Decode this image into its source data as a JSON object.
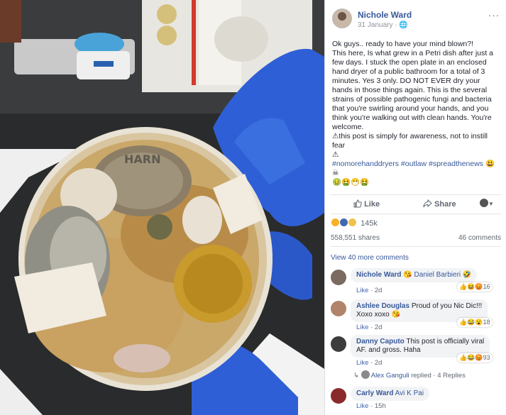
{
  "post": {
    "author": "Nichole Ward",
    "date": "31 January · ",
    "more": "···",
    "text": "Ok guys.. ready to have your mind blown?!\nThis here, Is what grew in a Petri dish after just a few days. I stuck the open plate in an enclosed hand dryer of a public bathroom for a total of 3 minutes. Yes 3 only. DO NOT EVER dry your hands in those things again. This is the several strains of possible pathogenic fungi and bacteria that you're swirling around your hands, and you think you're walking out with clean hands. You're welcome.",
    "warning": "this post is simply for awareness, not to instill fear",
    "hashtags": "#nomorehanddryers #outlaw #spreadthenews"
  },
  "photo": {
    "plate_label": "HARN"
  },
  "actions": {
    "like": "Like",
    "share": "Share"
  },
  "stats": {
    "reactions": "145k",
    "shares": "558,551 shares",
    "comments": "46 comments"
  },
  "view_more": "View 40 more comments",
  "comments": [
    {
      "name": "Nichole Ward",
      "text": "Daniel Barbieri",
      "like": "Like",
      "time": "2d",
      "react_count": "16"
    },
    {
      "name": "Ashlee Douglas",
      "text": "Proud of you Nic Dic!!!",
      "text2": "Xoxo xoxo",
      "like": "Like",
      "time": "2d",
      "react_count": "18"
    },
    {
      "name": "Danny Caputo",
      "text": "This post is officially viral",
      "text2": "AF. and gross. Haha",
      "like": "Like",
      "time": "2d",
      "react_count": "93"
    },
    {
      "name": "Carly Ward",
      "text": "Avi K Pai",
      "like": "Like",
      "time": "15h"
    }
  ],
  "reply": {
    "name": "Alex Ganguli",
    "label": "replied",
    "count": "· 4 Replies"
  },
  "colors": {
    "link": "#365899",
    "like_blue": "#4267b2",
    "glove": "#2e5fd6"
  }
}
